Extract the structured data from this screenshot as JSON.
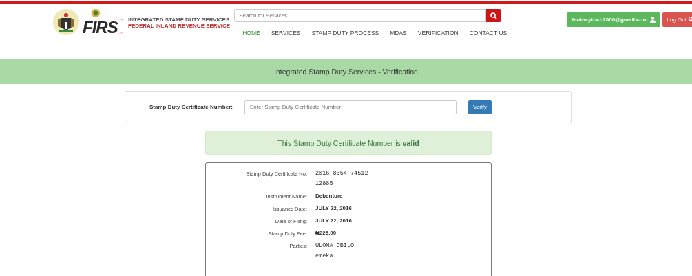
{
  "brand": {
    "title": "INTEGRATED STAMP DUTY SERVICES",
    "subtitle": "FEDERAL INLAND REVENUE SERVICE",
    "logo_text": "FIRS"
  },
  "search": {
    "placeholder": "Search for Services"
  },
  "user": {
    "email": "fantasytoch2000@gmail.com",
    "logout": "Log Out"
  },
  "nav": [
    {
      "label": "HOME",
      "selected": true
    },
    {
      "label": "SERVICES",
      "selected": false
    },
    {
      "label": "STAMP DUTY PROCESS",
      "selected": false
    },
    {
      "label": "MDAS",
      "selected": false
    },
    {
      "label": "VERIFICATION",
      "selected": false
    },
    {
      "label": "CONTACT US",
      "selected": false
    }
  ],
  "banner": "Integrated Stamp Duty Services - Verification",
  "form": {
    "label": "Stamp Duty Certificate Number:",
    "placeholder": "Enter Stamp Duty Certificate Number",
    "button": "Verify"
  },
  "alert": "This Stamp Duty Certificate Number is **valid**",
  "details": [
    {
      "label": "Stamp Duty Certificate No:",
      "kind": "mono",
      "lines": [
        "2016-8354-74512-",
        "12885"
      ]
    },
    {
      "label": "Instrument Name:",
      "kind": "bold",
      "lines": [
        "Debenture"
      ]
    },
    {
      "label": "Issuance Date:",
      "kind": "bold",
      "lines": [
        "JULY 22, 2016"
      ]
    },
    {
      "label": "Date of Filing:",
      "kind": "bold",
      "lines": [
        "JULY 22, 2016"
      ]
    },
    {
      "label": "Stamp Duty Fee:",
      "kind": "bold",
      "lines": [
        "₦225.00"
      ]
    },
    {
      "label": "Parties:",
      "kind": "mono",
      "lines": [
        "ULOMA OBILO",
        "emeka"
      ]
    }
  ]
}
